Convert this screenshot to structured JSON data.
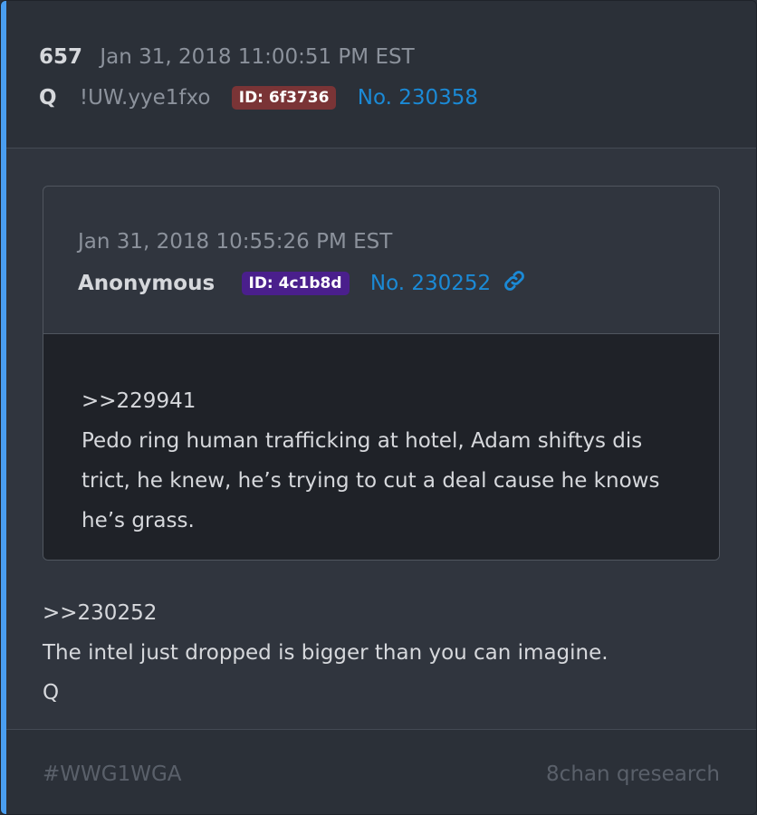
{
  "post": {
    "number": "657",
    "date": "Jan 31, 2018 11:00:51 PM EST",
    "author": "Q",
    "tripcode": "!UW.yye1fxo",
    "id_badge": "ID: 6f3736",
    "post_no": "No. 230358"
  },
  "quoted": {
    "date": "Jan 31, 2018 10:55:26 PM EST",
    "author": "Anonymous",
    "id_badge": "ID: 4c1b8d",
    "post_no": "No. 230252",
    "ref": ">>229941",
    "text": "Pedo ring human trafficking at hotel, Adam shiftys dis trict, he knew, he’s trying to cut a deal cause he knows he’s grass."
  },
  "body": {
    "ref": ">>230252",
    "line1": "The intel just dropped is bigger than you can imagine.",
    "signature": "Q"
  },
  "footer": {
    "hashtag": "#WWG1WGA",
    "source": "8chan qresearch"
  },
  "colors": {
    "accent": "#4a9ef0",
    "link": "#1b8ad6",
    "id_red": "#7a3436",
    "id_purple": "#4a1f8c"
  },
  "icons": {
    "permalink": "link-icon"
  }
}
